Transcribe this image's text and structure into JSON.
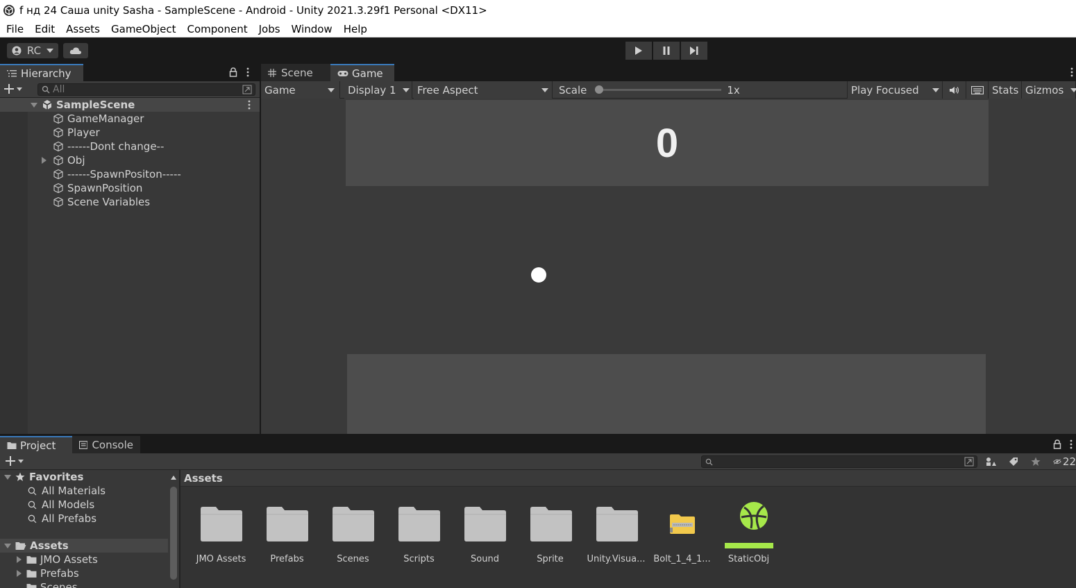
{
  "window": {
    "title": "f нд 24 Саша unity Sasha - SampleScene - Android - Unity 2021.3.29f1 Personal <DX11>"
  },
  "menu": [
    "File",
    "Edit",
    "Assets",
    "GameObject",
    "Component",
    "Jobs",
    "Window",
    "Help"
  ],
  "toolbar": {
    "account_label": "RC"
  },
  "hierarchy": {
    "tab_label": "Hierarchy",
    "search_placeholder": "All",
    "scene_name": "SampleScene",
    "items": [
      "GameManager",
      "Player",
      "------Dont change--",
      "Obj",
      "------SpawnPositon-----",
      "SpawnPosition",
      "Scene Variables"
    ]
  },
  "view_tabs": {
    "scene": "Scene",
    "game": "Game"
  },
  "game_toolbar": {
    "mode": "Game",
    "display": "Display 1",
    "aspect": "Free Aspect",
    "scale_label": "Scale",
    "scale_value": "1x",
    "scale_fraction": 0.0,
    "play_mode": "Play Focused",
    "stats": "Stats",
    "gizmos": "Gizmos"
  },
  "game_view": {
    "score": "0"
  },
  "bottom_tabs": {
    "project": "Project",
    "console": "Console"
  },
  "project": {
    "favorites_label": "Favorites",
    "favorites": [
      "All Materials",
      "All Models",
      "All Prefabs"
    ],
    "assets_label": "Assets",
    "asset_tree": [
      "JMO Assets",
      "Prefabs",
      "Scenes"
    ],
    "breadcrumb": "Assets",
    "hidden_count": "22",
    "assets": [
      {
        "name": "JMO Assets",
        "kind": "folder"
      },
      {
        "name": "Prefabs",
        "kind": "folder"
      },
      {
        "name": "Scenes",
        "kind": "folder"
      },
      {
        "name": "Scripts",
        "kind": "folder"
      },
      {
        "name": "Sound",
        "kind": "folder"
      },
      {
        "name": "Sprite",
        "kind": "folder"
      },
      {
        "name": "Unity.Visua...",
        "kind": "folder"
      },
      {
        "name": "Bolt_1_4_1...",
        "kind": "package"
      },
      {
        "name": "StaticObj",
        "kind": "prefab"
      }
    ]
  },
  "colors": {
    "accent": "#3a79bb",
    "static_obj_green": "#a6e84a",
    "package_yellow": "#f2c94c"
  }
}
